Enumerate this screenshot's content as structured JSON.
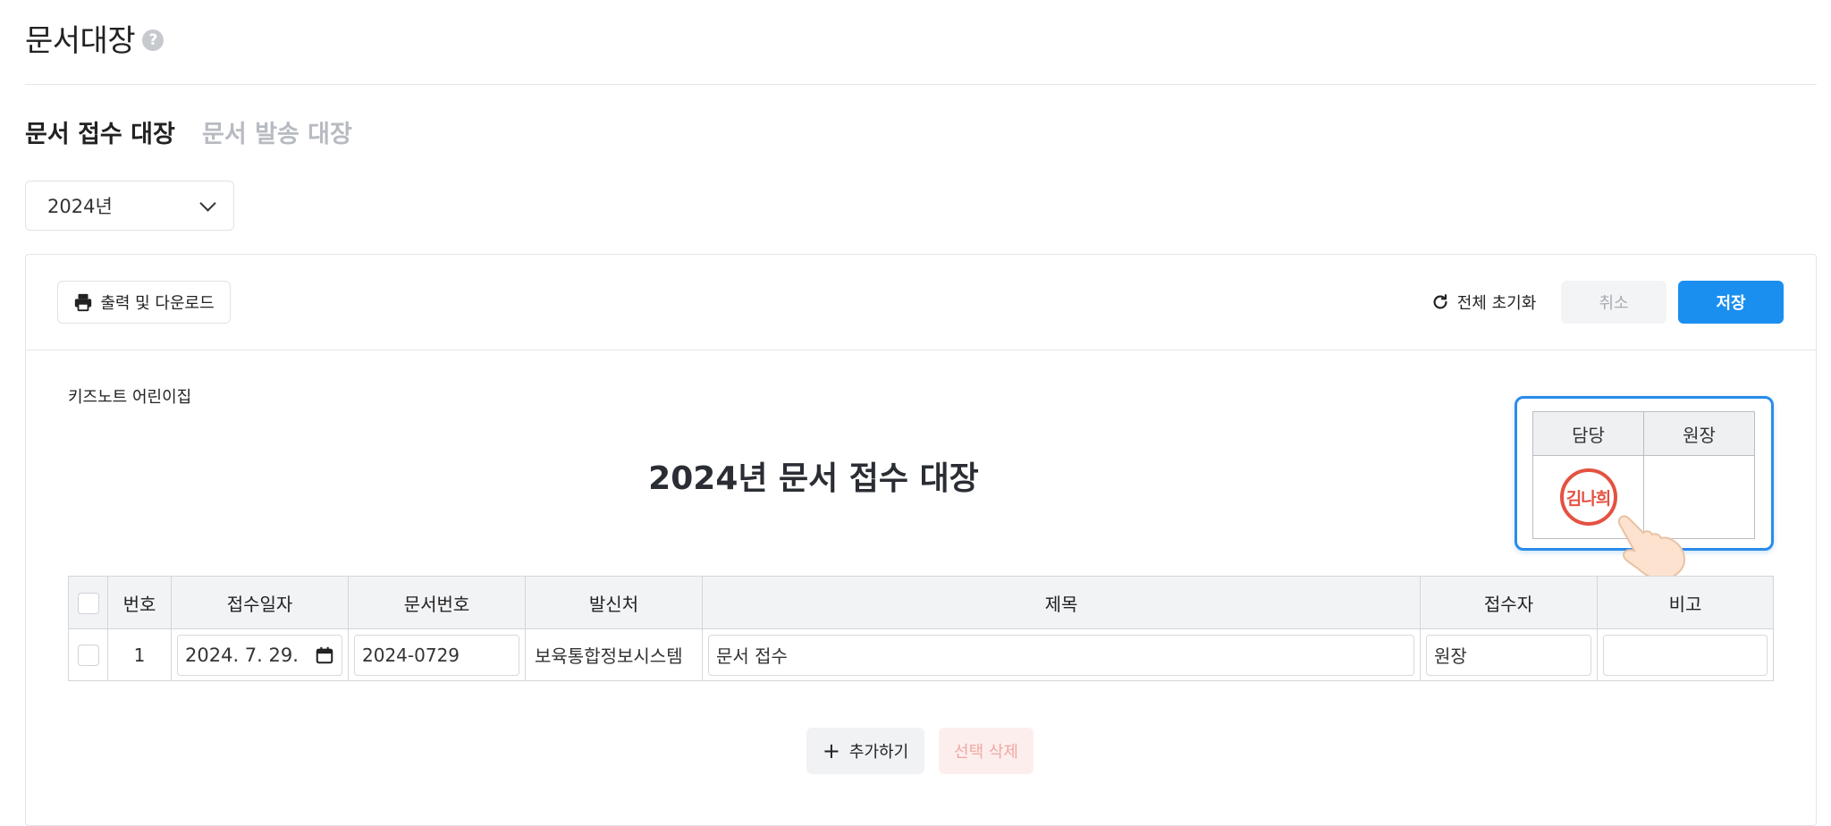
{
  "page": {
    "title": "문서대장",
    "help_icon": "question-circle-icon"
  },
  "tabs": [
    {
      "label": "문서 접수 대장",
      "active": true
    },
    {
      "label": "문서 발송 대장",
      "active": false
    }
  ],
  "year_select": {
    "value": "2024년"
  },
  "toolbar": {
    "print_label": "출력 및 다운로드",
    "reset_label": "전체 초기화",
    "cancel_label": "취소",
    "save_label": "저장"
  },
  "document": {
    "org_name": "키즈노트 어린이집",
    "title": "2024년 문서 접수 대장"
  },
  "approval": {
    "headers": [
      "담당",
      "원장"
    ],
    "stamp_text": "김나희"
  },
  "table": {
    "columns": [
      "번호",
      "접수일자",
      "문서번호",
      "발신처",
      "제목",
      "접수자",
      "비고"
    ],
    "rows": [
      {
        "no": "1",
        "date": "2024. 7. 29.",
        "doc_no": "2024-0729",
        "sender": "보육통합정보시스템",
        "subject": "문서 접수",
        "receiver": "원장",
        "note": ""
      }
    ]
  },
  "actions": {
    "add_label": "추가하기",
    "delete_label": "선택 삭제"
  },
  "colors": {
    "primary": "#1a8ff0",
    "stamp": "#e45242",
    "approval_border": "#2a8ce8"
  }
}
